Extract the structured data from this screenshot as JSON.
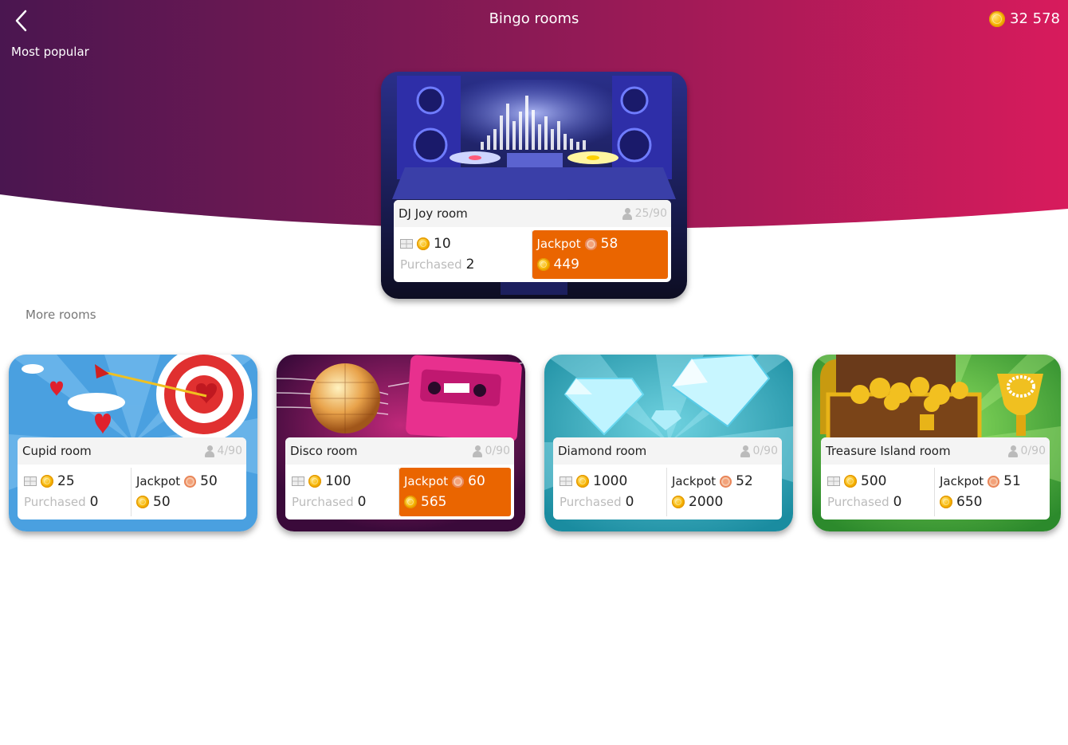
{
  "header": {
    "title": "Bingo rooms",
    "balance": "32 578"
  },
  "sections": {
    "popular": "Most popular",
    "more": "More rooms"
  },
  "labels": {
    "jackpot": "Jackpot",
    "purchased": "Purchased"
  },
  "featured": {
    "name": "DJ Joy room",
    "players": "25/90",
    "ticket_price": "10",
    "purchased": "2",
    "jackpot_tokens": "58",
    "jackpot_coins": "449",
    "jackpot_highlight": true
  },
  "rooms": [
    {
      "name": "Cupid room",
      "players": "4/90",
      "ticket_price": "25",
      "purchased": "0",
      "jackpot_tokens": "50",
      "jackpot_coins": "50",
      "jackpot_highlight": false
    },
    {
      "name": "Disco room",
      "players": "0/90",
      "ticket_price": "100",
      "purchased": "0",
      "jackpot_tokens": "60",
      "jackpot_coins": "565",
      "jackpot_highlight": true
    },
    {
      "name": "Diamond room",
      "players": "0/90",
      "ticket_price": "1000",
      "purchased": "0",
      "jackpot_tokens": "52",
      "jackpot_coins": "2000",
      "jackpot_highlight": false
    },
    {
      "name": "Treasure Island room",
      "players": "0/90",
      "ticket_price": "500",
      "purchased": "0",
      "jackpot_tokens": "51",
      "jackpot_coins": "650",
      "jackpot_highlight": false
    }
  ],
  "colors": {
    "header_start": "#4a1650",
    "header_end": "#d81b5c",
    "jackpot_orange": "#ea6500"
  }
}
